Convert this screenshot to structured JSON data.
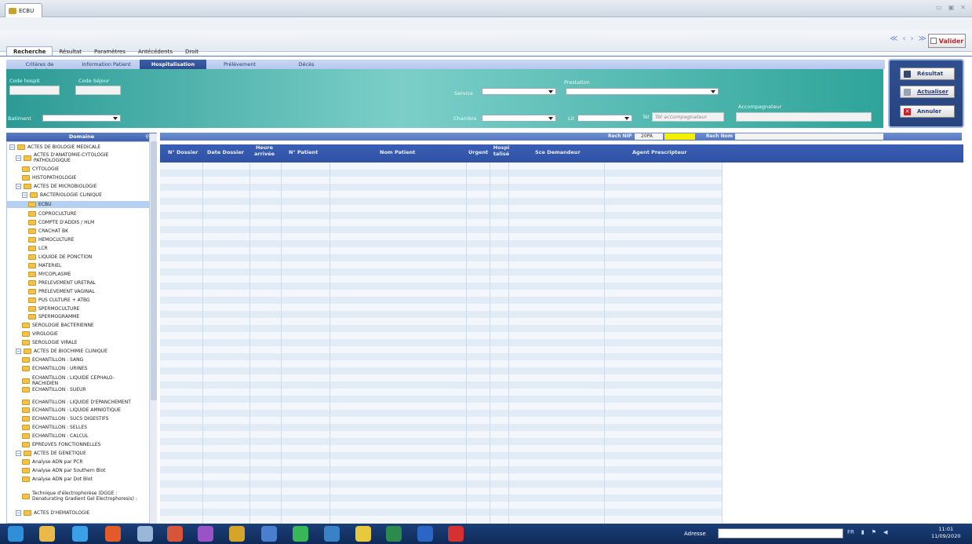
{
  "window": {
    "tab_title": "ECBU",
    "controls": [
      "▭",
      "▣",
      "✕"
    ]
  },
  "nav": {
    "arrows": [
      "≪",
      "‹",
      "›",
      "≫"
    ],
    "valider": "Valider"
  },
  "main_tabs": [
    "Recherche",
    "Résultat",
    "Paramètres",
    "Antécédents",
    "Droit"
  ],
  "sub_tabs": [
    "Critères de recherche",
    "Information Patient",
    "Hospitalisation",
    "Prélèvement",
    "Décès"
  ],
  "filters": {
    "code_hospit": "Code hospit",
    "code_sejour": "Code Séjour",
    "batiment": "Batiment",
    "service": "Service",
    "prestation": "Prestation",
    "chambre": "Chambre",
    "lit": "Lit",
    "tel_label": "Tél",
    "tel_placeholder": "Tél accompagnateur",
    "accompagnateur": "Accompagnateur"
  },
  "actions": {
    "resultat": "Résultat",
    "actualiser": "Actualiser",
    "annuler": "Annuler"
  },
  "tree": {
    "header": "Domaine",
    "items": [
      "ACTES DE BIOLOGIE MEDICALE",
      "ACTES D'ANATOMIE-CYTOLOGIE PATHOLOGIQUE",
      "CYTOLOGIE",
      "HISTOPATHOLOGIE",
      "ACTES DE MICROBIOLOGIE",
      "BACTERIOLOGIE CLINIQUE",
      "ECBU",
      "COPROCULTURE",
      "COMPTE D'ADDIS / HLM",
      "CRACHAT BK",
      "HEMOCULTURE",
      "LCR",
      "LIQUIDE DE PONCTION",
      "MATERIEL",
      "MYCOPLASME",
      "PRELEVEMENT URETRAL",
      "PRELEVEMENT VAGINAL",
      "PUS CULTURE + ATBG",
      "SPERMOCULTURE",
      "SPERMOGRAMME",
      "SEROLOGIE BACTERIENNE",
      "VIROLOGIE",
      "SEROLOGIE VIRALE",
      "ACTES DE BIOCHIMIE CLINIQUE",
      "ECHANTILLON : SANG",
      "ECHANTILLON : URINES",
      "ECHANTILLON : LIQUIDE CEPHALO-RACHIDIEN",
      "ECHANTILLON : SUEUR",
      "ECHANTILLON : LIQUIDE D'EPANCHEMENT",
      "ECHANTILLON : LIQUIDE AMNIOTIQUE",
      "ECHANTILLON : SUCS DIGESTIFS",
      "ECHANTILLON : SELLES",
      "ECHANTILLON : CALCUL",
      "EPREUVES FONCTIONNELLES",
      "ACTES DE GENETIQUE",
      "Analyse ADN par PCR",
      "Analyse ADN par Southern Blot",
      "Analyse ADN par Dot Blot",
      "Technique d'électrophorèse (DGGE : Denaturating Gradient Gel Electrophoresis) :",
      "ACTES D'HEMATOLOGIE"
    ]
  },
  "grid": {
    "rech_nip": "Rech NIP",
    "rech_nip_value": "20PA",
    "rech_nom": "Rech Nom",
    "columns": [
      "N° Dossier",
      "Date Dossier",
      "Heure arrivée",
      "N° Patient",
      "Nom Patient",
      "Urgent",
      "Hospi talisé",
      "Sce Demandeur",
      "Agent Prescripteur"
    ]
  },
  "taskbar": {
    "adresse": "Adresse",
    "lang": "FR",
    "time": "11:01",
    "date": "11/09/2020"
  }
}
